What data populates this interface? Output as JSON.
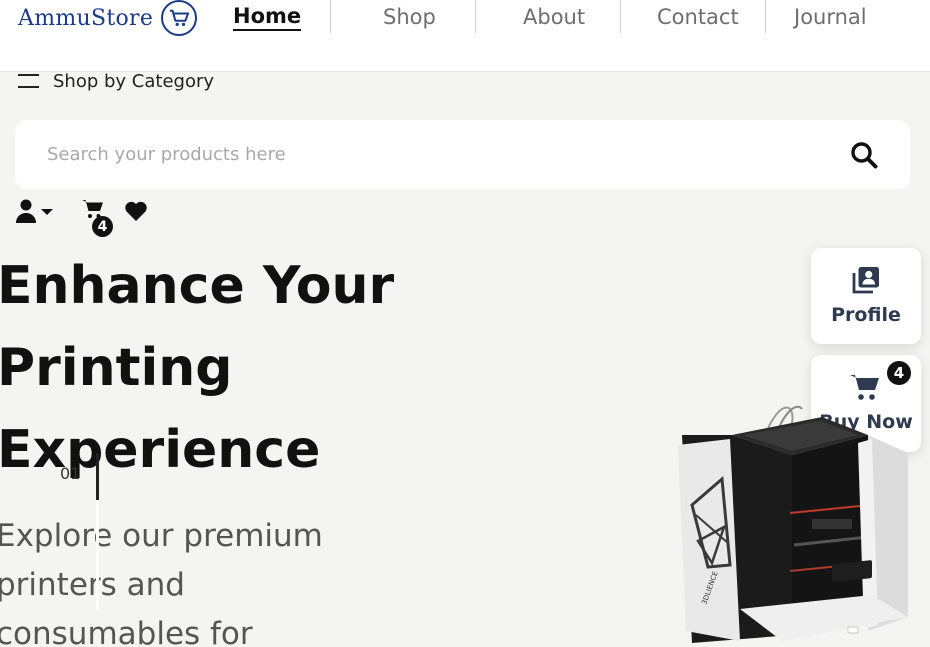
{
  "brand": {
    "name": "AmmuStore",
    "icon": "cart-icon"
  },
  "nav": {
    "home": "Home",
    "shop": "Shop",
    "about": "About",
    "contact": "Contact",
    "journal": "Journal"
  },
  "category": {
    "label": "Shop by Category",
    "icon": "hamburger-icon"
  },
  "search": {
    "placeholder": "Search your products here",
    "value": "",
    "icon": "search-icon"
  },
  "toolbar": {
    "user_icon": "user-icon",
    "cart_icon": "cart-icon",
    "cart_count": "4",
    "wishlist_icon": "heart-icon"
  },
  "hero": {
    "title": "Enhance Your Printing Experience",
    "description": "Explore our premium printers and consumables for",
    "slide_number": "01"
  },
  "side_panel": {
    "profile": {
      "label": "Profile",
      "icon": "profile-icon"
    },
    "buy_now": {
      "label": "Buy Now",
      "icon": "cart-icon",
      "count": "4"
    }
  },
  "colors": {
    "brand": "#1c3a8a",
    "side_label": "#2d3a50",
    "background": "#f4f4f2"
  }
}
